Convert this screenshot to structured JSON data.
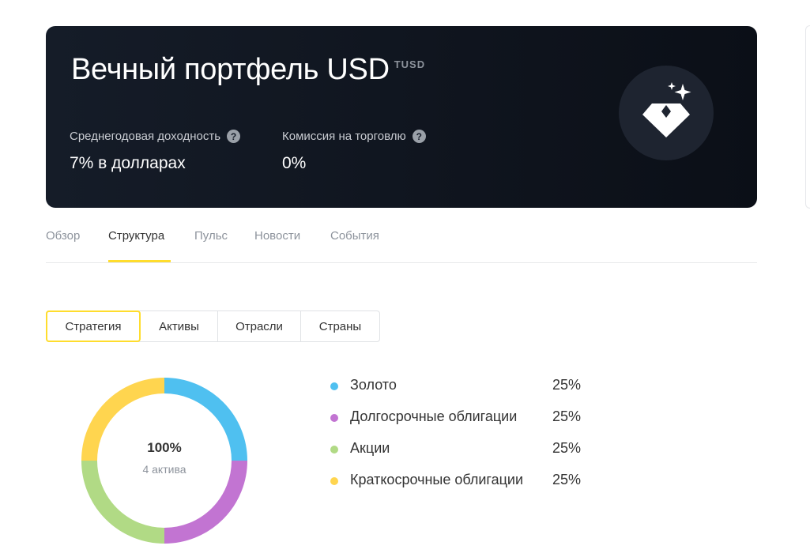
{
  "header": {
    "title": "Вечный портфель USD",
    "ticker": "TUSD",
    "metrics": [
      {
        "label": "Среднегодовая доходность",
        "help": "?",
        "value": "7% в долларах"
      },
      {
        "label": "Комиссия на торговлю",
        "help": "?",
        "value": "0%"
      }
    ],
    "badge_icon": "diamond-sparkle-icon"
  },
  "tabs": [
    {
      "label": "Обзор",
      "active": false
    },
    {
      "label": "Структура",
      "active": true
    },
    {
      "label": "Пульс",
      "active": false
    },
    {
      "label": "Новости",
      "active": false
    },
    {
      "label": "События",
      "active": false
    }
  ],
  "segments": [
    {
      "label": "Стратегия",
      "active": true
    },
    {
      "label": "Активы",
      "active": false
    },
    {
      "label": "Отрасли",
      "active": false
    },
    {
      "label": "Страны",
      "active": false
    }
  ],
  "donut": {
    "total": "100%",
    "subtitle": "4 актива"
  },
  "chart_data": {
    "type": "pie",
    "categories": [
      "Золото",
      "Долгосрочные облигации",
      "Акции",
      "Краткосрочные облигации"
    ],
    "values": [
      25,
      25,
      25,
      25
    ],
    "value_labels": [
      "25%",
      "25%",
      "25%",
      "25%"
    ],
    "colors": [
      "#4fc0f0",
      "#c274d2",
      "#b1da85",
      "#ffd54f"
    ]
  },
  "colors": {
    "accent": "#ffdd2d",
    "hero_background": "#0f141d"
  }
}
